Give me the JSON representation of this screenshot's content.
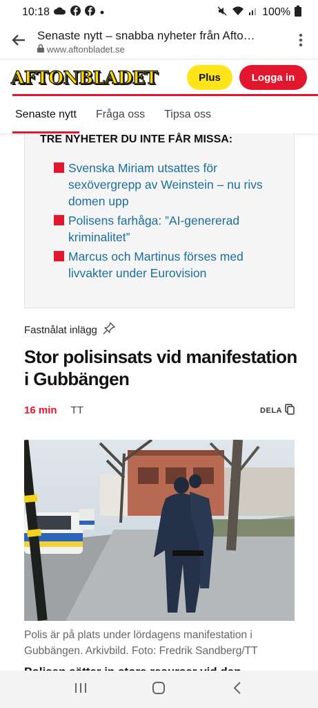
{
  "status_bar": {
    "time": "10:18",
    "battery": "100%"
  },
  "browser": {
    "page_title": "Senaste nytt – snabba nyheter från Afto…",
    "url": "www.aftonbladet.se"
  },
  "site": {
    "logo_text": "AFTONBLADET",
    "plus_label": "Plus",
    "login_label": "Logga in"
  },
  "tabs": [
    {
      "label": "Senaste nytt"
    },
    {
      "label": "Fråga oss"
    },
    {
      "label": "Tipsa oss"
    }
  ],
  "must_read": {
    "heading": "TRE NYHETER DU INTE FÅR MISSA:",
    "items": [
      {
        "text": "Svenska Miriam utsattes för sexövergrepp av Weinstein – nu rivs domen upp"
      },
      {
        "text": "Polisens farhåga: ”AI-genererad kriminalitet”"
      },
      {
        "text": "Marcus och Martinus förses med livvakter under Eurovision"
      }
    ]
  },
  "article": {
    "pinned_label": "Fastnålat inlägg",
    "headline": "Stor polisinsats vid manifestation i Gubbängen",
    "time": "16 min",
    "source": "TT",
    "share_label": "DELA",
    "caption": "Polis är på plats under lördagens manifestation i Gubbängen. Arkivbild. Foto: Fredrik Sandberg/TT",
    "next_headline_partial": "Polisen sätter in stora resurser vid den"
  },
  "colors": {
    "accent_red": "#e2162d",
    "plus_yellow": "#ffe418",
    "link_blue": "#1a6ea0"
  },
  "icons": [
    "cloud-icon",
    "facebook-icon",
    "wifi-icon",
    "signal-icon",
    "battery-icon",
    "mute-icon",
    "back-arrow-icon",
    "lock-icon",
    "more-vert-icon",
    "pin-icon",
    "copy-icon",
    "recents-icon",
    "home-icon",
    "back-nav-icon"
  ]
}
